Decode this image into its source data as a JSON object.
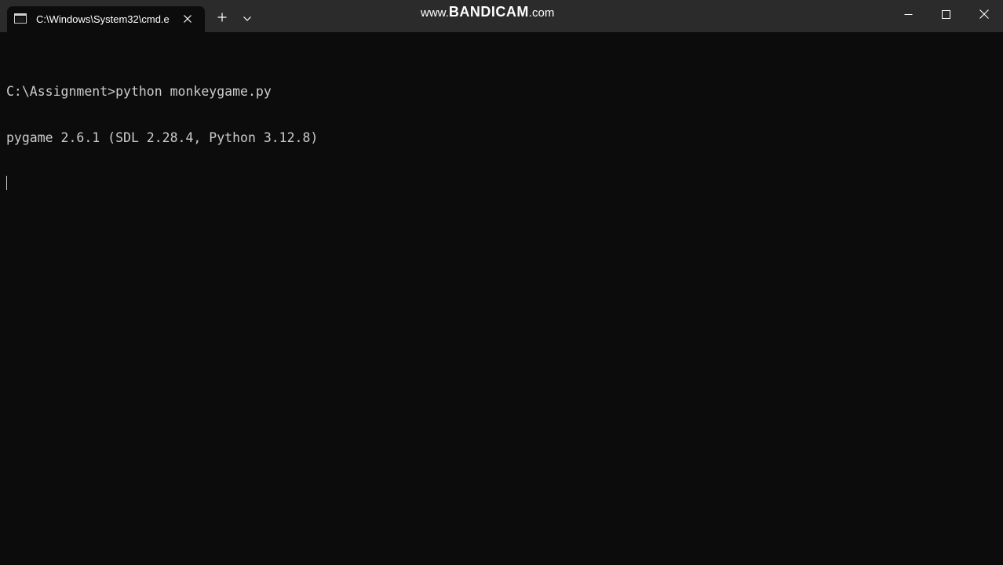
{
  "tab": {
    "title": "C:\\Windows\\System32\\cmd.e",
    "icon": "terminal-icon"
  },
  "toolbar": {
    "new_tab_icon": "plus-icon",
    "dropdown_icon": "chevron-down-icon"
  },
  "watermark": {
    "prefix": "www.",
    "brand": "BANDICAM",
    "suffix": ".com"
  },
  "window_controls": {
    "minimize_icon": "minimize-icon",
    "maximize_icon": "maximize-icon",
    "close_icon": "close-icon"
  },
  "console": {
    "lines": [
      "C:\\Assignment>python monkeygame.py",
      "pygame 2.6.1 (SDL 2.28.4, Python 3.12.8)"
    ]
  },
  "colors": {
    "titlebar_bg": "#2b2b2b",
    "console_bg": "#0c0c0c",
    "console_fg": "#cccccc"
  }
}
